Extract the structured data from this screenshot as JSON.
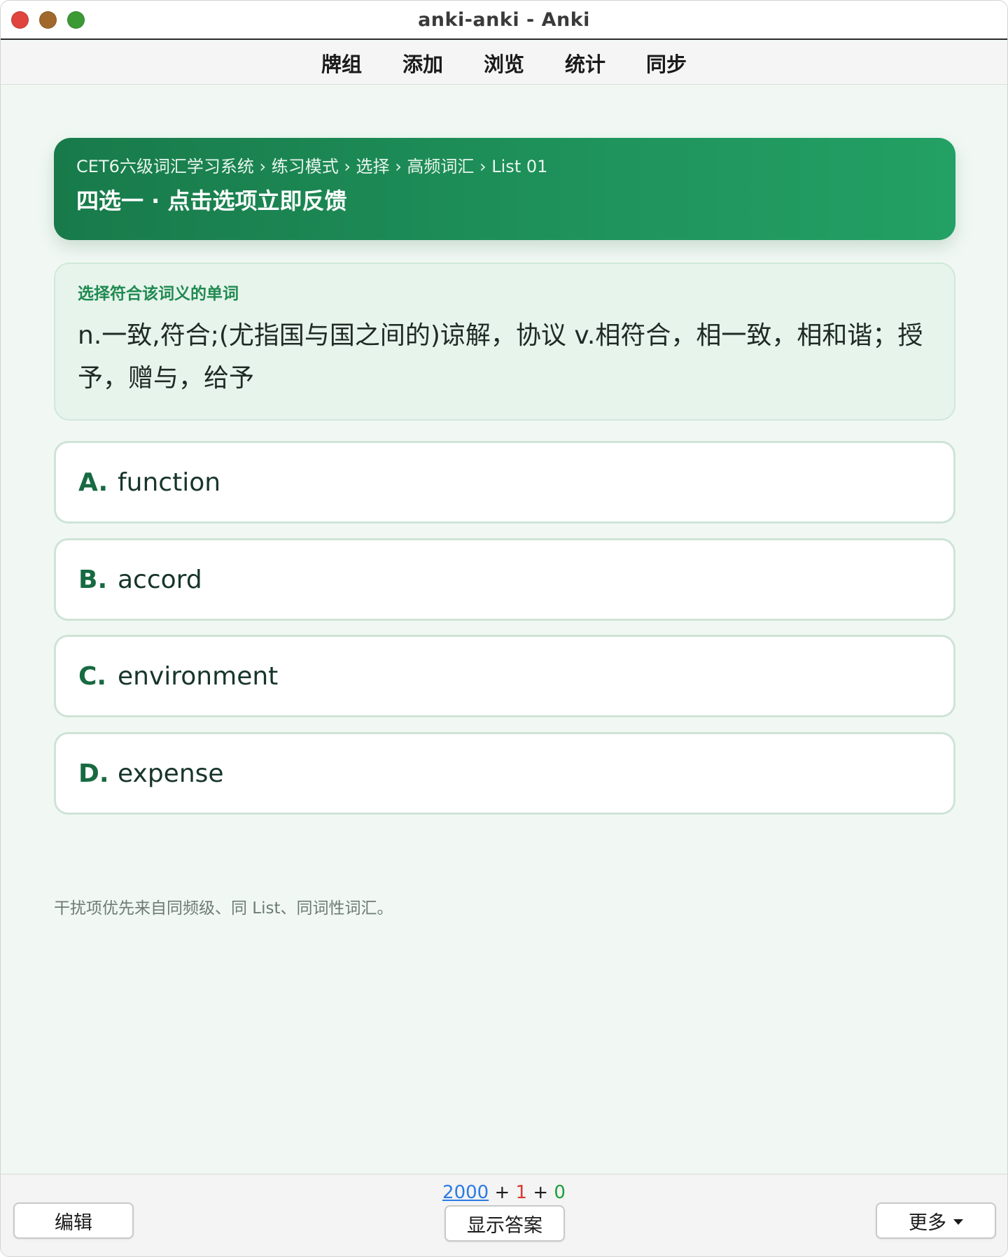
{
  "window": {
    "title": "anki-anki - Anki"
  },
  "toolbar": {
    "items": [
      "牌组",
      "添加",
      "浏览",
      "统计",
      "同步"
    ]
  },
  "header": {
    "breadcrumb": "CET6六级词汇学习系统 › 练习模式 › 选择 › 高频词汇 › List 01",
    "title": "四选一 · 点击选项立即反馈"
  },
  "question": {
    "label": "选择符合该词义的单词",
    "definition": "n.一致,符合;(尤指国与国之间的)谅解，协议 v.相符合，相一致，相和谐；授予，赠与，给予"
  },
  "options": [
    {
      "letter": "A.",
      "word": "function"
    },
    {
      "letter": "B.",
      "word": "accord"
    },
    {
      "letter": "C.",
      "word": "environment"
    },
    {
      "letter": "D.",
      "word": "expense"
    }
  ],
  "note": "干扰项优先来自同频级、同 List、同词性词汇。",
  "bottom": {
    "count_new": "2000",
    "plus1": "+",
    "count_learn": "1",
    "plus2": "+",
    "count_review": "0",
    "edit_label": "编辑",
    "show_answer_label": "显示答案",
    "more_label": "更多"
  },
  "colors": {
    "accent": "#1f935c",
    "count_new": "#2c7be5",
    "count_learn": "#d83a2f",
    "count_review": "#1e9e3c"
  },
  "icons": {
    "more_dropdown": "caret-down-icon"
  }
}
